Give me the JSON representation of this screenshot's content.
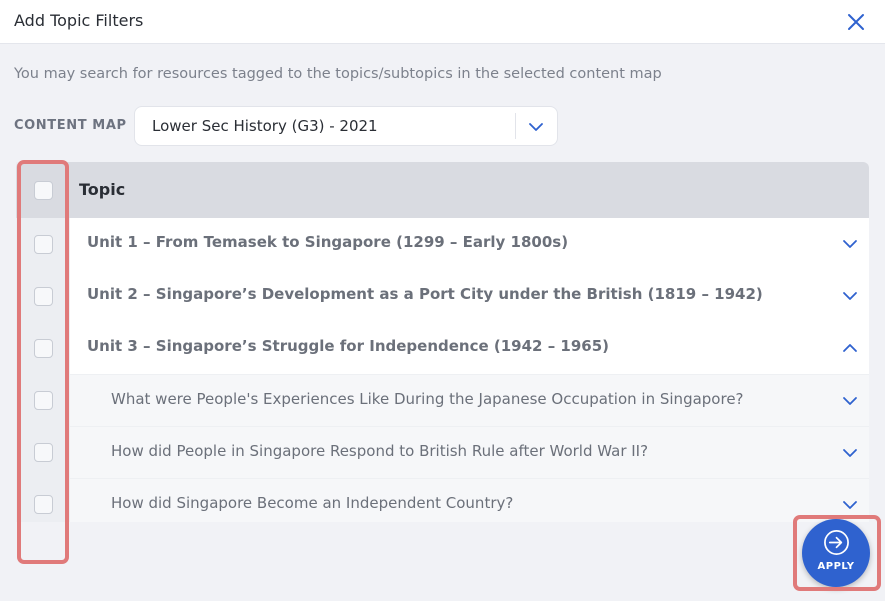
{
  "dialog": {
    "title": "Add Topic Filters"
  },
  "description": "You may search for resources tagged to the topics/subtopics in the selected content map",
  "content_map": {
    "label": "CONTENT MAP",
    "value": "Lower Sec History (G3) - 2021"
  },
  "table": {
    "header": "Topic",
    "rows": [
      {
        "label": "Unit 1 – From Temasek to Singapore (1299 – Early 1800s)",
        "type": "unit",
        "expanded": false
      },
      {
        "label": "Unit 2 – Singapore’s Development as a Port City under the British (1819 – 1942)",
        "type": "unit",
        "expanded": false
      },
      {
        "label": "Unit 3 – Singapore’s Struggle for Independence (1942 – 1965)",
        "type": "unit",
        "expanded": true
      },
      {
        "label": "What were People's Experiences Like During the Japanese Occupation in Singapore?",
        "type": "subtopic",
        "expanded": false
      },
      {
        "label": "How did People in Singapore Respond to British Rule after World War II?",
        "type": "subtopic",
        "expanded": false
      },
      {
        "label": "How did Singapore Become an Independent Country?",
        "type": "subtopic",
        "expanded": false
      }
    ]
  },
  "apply_button": {
    "label": "APPLY"
  },
  "colors": {
    "accent": "#2f62cf",
    "highlight": "#e07a7a",
    "header_bg": "#d9dbe1"
  }
}
